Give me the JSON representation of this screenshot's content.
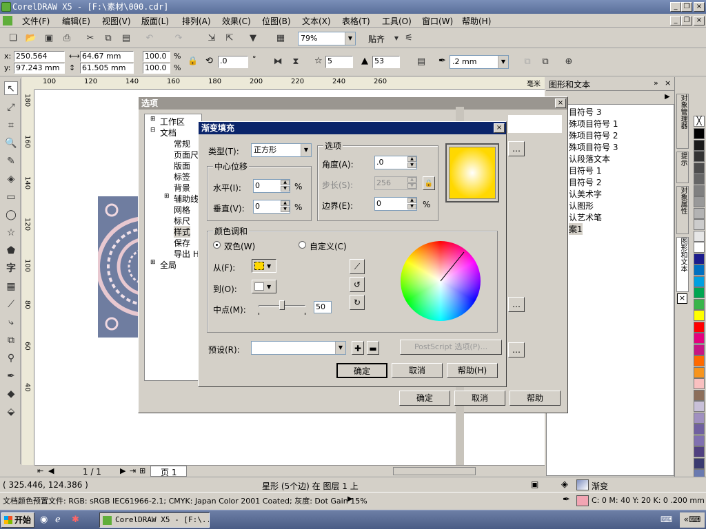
{
  "window": {
    "title": "CorelDRAW X5 - [F:\\素材\\000.cdr]"
  },
  "menu": [
    "文件(F)",
    "编辑(E)",
    "视图(V)",
    "版面(L)",
    "排列(A)",
    "效果(C)",
    "位图(B)",
    "文本(X)",
    "表格(T)",
    "工具(O)",
    "窗口(W)",
    "帮助(H)"
  ],
  "toolbar": {
    "zoom": "79%",
    "snap_label": "贴齐"
  },
  "propbar": {
    "x": "250.564 mm",
    "y": "97.243 mm",
    "w": "64.67 mm",
    "h": "61.505 mm",
    "sx": "100.0",
    "sy": "100.0",
    "pct": "%",
    "angle": ".0",
    "deg": "°",
    "points": "5",
    "sharp": "53",
    "outline": ".2 mm"
  },
  "ruler": {
    "h": [
      "100",
      "120",
      "140",
      "160",
      "180",
      "200",
      "220",
      "240",
      "260"
    ],
    "v": [
      "180",
      "160",
      "140",
      "120",
      "100",
      "80",
      "60",
      "40"
    ],
    "unit": "毫米"
  },
  "pageNav": {
    "count": "1 / 1",
    "tab": "页 1"
  },
  "docker": {
    "title": "图形和文本",
    "items": [
      "目符号 3",
      "殊项目符号 1",
      "殊项目符号 2",
      "殊项目符号 3",
      "认段落文本",
      "目符号 1",
      "目符号 2",
      "认美术字",
      "认图形",
      "认艺术笔",
      "案1"
    ],
    "tabs": [
      "对象管理器",
      "提示",
      "对象属性",
      "图形和文本"
    ]
  },
  "palette": [
    "#ffffff",
    "#000000",
    "#1a1a1a",
    "#333333",
    "#4d4d4d",
    "#666666",
    "#808080",
    "#999999",
    "#b3b3b3",
    "#cccccc",
    "#e6e6e6",
    "#ffffff",
    "#1b1b8c",
    "#0070c0",
    "#00a0e0",
    "#00a651",
    "#39b54a",
    "#ffff00",
    "#ff0000",
    "#e4007f",
    "#c71585",
    "#ff6a00",
    "#f7941d",
    "#f9c0c0",
    "#8c6e5a",
    "#c8c0d8",
    "#a090c0",
    "#7060a0",
    "#8070b0",
    "#504080",
    "#3a3a70",
    "#6a7ab0"
  ],
  "options": {
    "title": "选项",
    "tree": [
      "工作区",
      "文档",
      "常规",
      "页面尺",
      "版面",
      "标签",
      "背景",
      "辅助线",
      "网格",
      "标尺",
      "样式",
      "保存",
      "导出 H",
      "全局"
    ],
    "ok": "确定",
    "cancel": "取消",
    "help": "帮助"
  },
  "gradient": {
    "title": "渐变填充",
    "type_label": "类型(T):",
    "type_value": "正方形",
    "center_group": "中心位移",
    "horiz_label": "水平(I):",
    "horiz": "0",
    "vert_label": "垂直(V):",
    "vert": "0",
    "pct": "%",
    "opts_group": "选项",
    "angle_label": "角度(A):",
    "angle": ".0",
    "steps_label": "步长(S):",
    "steps": "256",
    "edge_label": "边界(E):",
    "edge": "0",
    "blend_group": "颜色调和",
    "two_color": "双色(W)",
    "custom": "自定义(C)",
    "from_label": "从(F):",
    "to_label": "到(O):",
    "mid_label": "中点(M):",
    "mid": "50",
    "preset_label": "预设(R):",
    "ps_btn": "PostScript 选项(P)...",
    "ok": "确定",
    "cancel": "取消",
    "help": "帮助(H)",
    "colors": {
      "from": "#ffd800",
      "to": "#ffffff"
    }
  },
  "status": {
    "coords": "( 325.446, 124.386 )",
    "object": "星形 (5个边) 在 图层 1 上",
    "fill": "渐变",
    "profile": "文档颜色预置文件: RGB: sRGB IEC61966-2.1; CMYK: Japan Color 2001 Coated; 灰度: Dot Gain 15%",
    "outline": "C: 0 M: 40 Y: 20 K: 0  .200 mm"
  },
  "taskbar": {
    "start": "开始",
    "task": "CorelDRAW X5 - [F:\\..."
  }
}
